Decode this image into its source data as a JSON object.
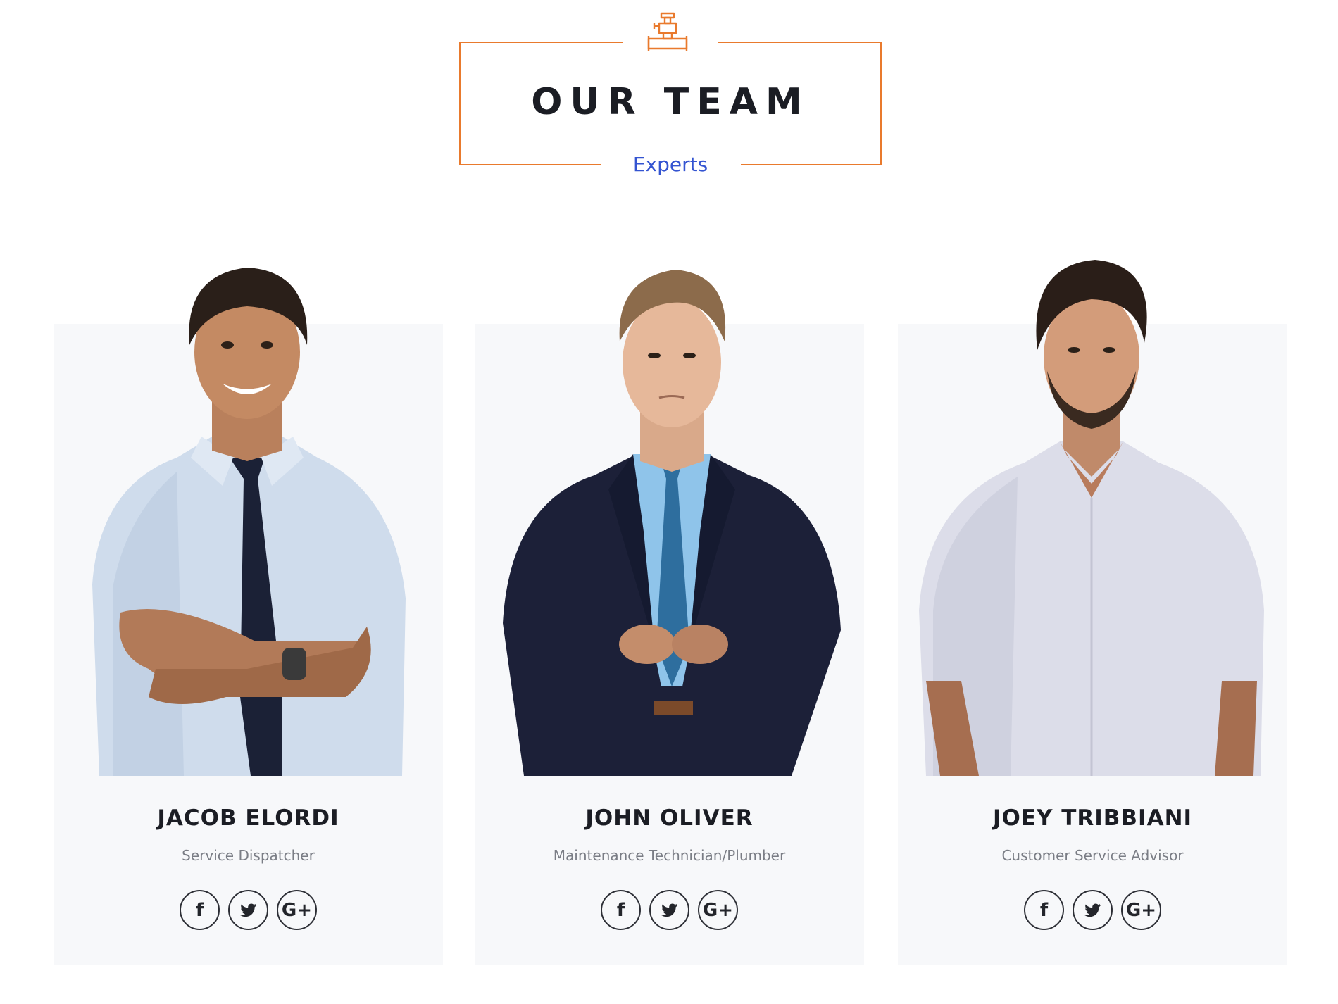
{
  "section": {
    "icon": "plumbing-pipe-icon",
    "title": "OUR TEAM",
    "subtitle": "Experts",
    "accent_color": "#e97a2d",
    "subtitle_color": "#3454d1"
  },
  "members": [
    {
      "name": "JACOB ELORDI",
      "role": "Service Dispatcher",
      "social": [
        {
          "icon": "facebook-icon",
          "glyph": "f"
        },
        {
          "icon": "twitter-icon",
          "glyph": ""
        },
        {
          "icon": "google-plus-icon",
          "glyph": "G+"
        }
      ]
    },
    {
      "name": "JOHN OLIVER",
      "role": "Maintenance Technician/Plumber",
      "social": [
        {
          "icon": "facebook-icon",
          "glyph": "f"
        },
        {
          "icon": "twitter-icon",
          "glyph": ""
        },
        {
          "icon": "google-plus-icon",
          "glyph": "G+"
        }
      ]
    },
    {
      "name": "JOEY TRIBBIANI",
      "role": "Customer Service Advisor",
      "social": [
        {
          "icon": "facebook-icon",
          "glyph": "f"
        },
        {
          "icon": "twitter-icon",
          "glyph": ""
        },
        {
          "icon": "google-plus-icon",
          "glyph": "G+"
        }
      ]
    }
  ]
}
